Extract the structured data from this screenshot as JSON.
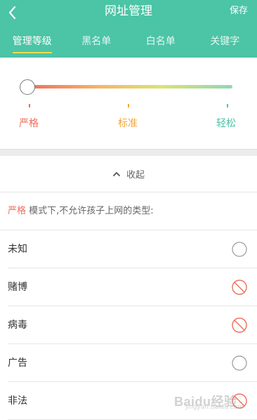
{
  "header": {
    "title": "网址管理",
    "save_label": "保存"
  },
  "tabs": [
    {
      "label": "管理等级",
      "active": true
    },
    {
      "label": "黑名单",
      "active": false
    },
    {
      "label": "白名单",
      "active": false
    },
    {
      "label": "关键字",
      "active": false
    }
  ],
  "level": {
    "current": "严格",
    "levels": [
      {
        "label": "严格",
        "color": "#ee6e5b"
      },
      {
        "label": "标准",
        "color": "#f2a63c"
      },
      {
        "label": "轻松",
        "color": "#4cc4a6"
      }
    ]
  },
  "collapse_label": "收起",
  "mode_description": {
    "mode": "严格",
    "text": " 模式下,不允许孩子上网的类型:"
  },
  "types": [
    {
      "label": "未知",
      "blocked": false
    },
    {
      "label": "赌博",
      "blocked": true
    },
    {
      "label": "病毒",
      "blocked": true
    },
    {
      "label": "广告",
      "blocked": false
    },
    {
      "label": "非法",
      "blocked": true
    }
  ],
  "colors": {
    "accent": "#4cc4a6",
    "tab_underline": "#f7d94c",
    "blocked": "#ee6e5b"
  },
  "watermark": {
    "text": "Baidu经验",
    "sub": "jingyan.baidu.com"
  }
}
